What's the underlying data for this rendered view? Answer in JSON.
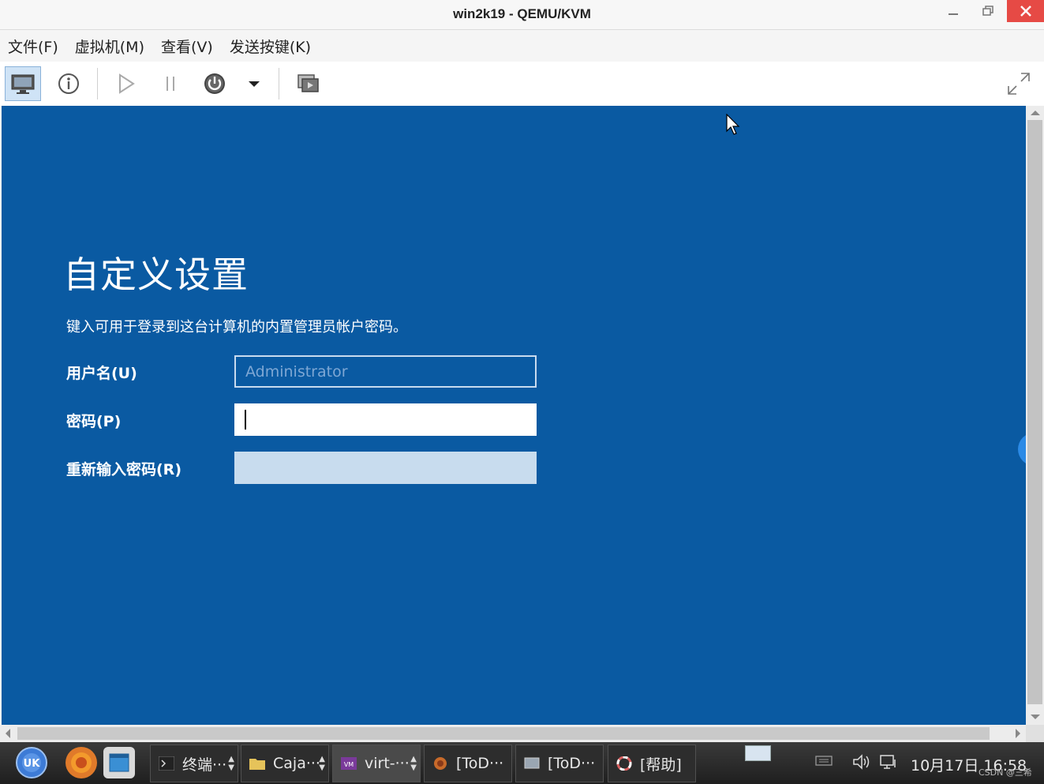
{
  "window": {
    "title": "win2k19 - QEMU/KVM"
  },
  "menu": {
    "items": [
      "文件(F)",
      "虚拟机(M)",
      "查看(V)",
      "发送按键(K)"
    ]
  },
  "toolbar": {
    "icons": [
      "monitor-icon",
      "info-icon",
      "play-icon",
      "pause-icon",
      "power-icon",
      "dropdown-icon",
      "screenshot-icon",
      "fullscreen-icon"
    ]
  },
  "setup": {
    "heading": "自定义设置",
    "description": "键入可用于登录到这台计算机的内置管理员帐户密码。",
    "username_label": "用户名(U)",
    "username_placeholder": "Administrator",
    "password_label": "密码(P)",
    "password_value": "",
    "reenter_label": "重新输入密码(R)",
    "reenter_value": ""
  },
  "colors": {
    "vm_background": "#0a5aa2",
    "accent": "#2b8ae6",
    "close_button": "#e64a45"
  },
  "taskbar": {
    "tasks": [
      {
        "label": "终端···",
        "icon": "terminal-icon"
      },
      {
        "label": "Caja···",
        "icon": "folder-icon"
      },
      {
        "label": "virt-···",
        "icon": "vm-icon"
      },
      {
        "label": "[ToD···",
        "icon": "app-icon"
      },
      {
        "label": "[ToD···",
        "icon": "window-icon"
      },
      {
        "label": "[帮助]",
        "icon": "help-icon"
      }
    ],
    "clock": "10月17日 16:58",
    "watermark": "CSDN @三希"
  }
}
